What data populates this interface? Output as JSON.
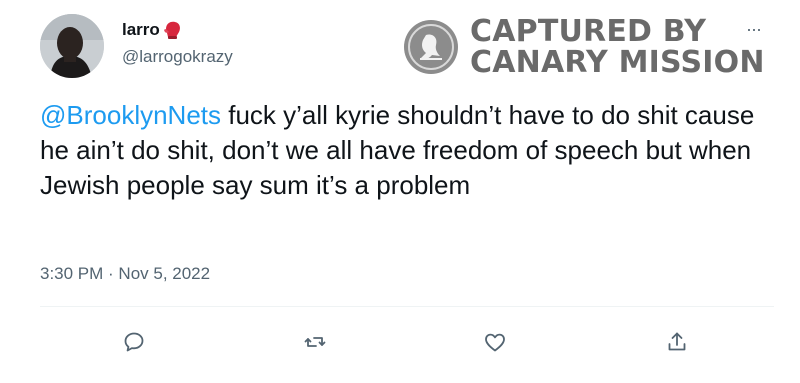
{
  "author": {
    "display_name": "larro",
    "handle": "@larrogokrazy",
    "badge_emoji": "boxing-glove-emoji"
  },
  "watermark": {
    "line1": "CAPTURED BY",
    "line2": "CANARY MISSION",
    "icon": "canary-bird-logo"
  },
  "tweet": {
    "mention": "@BrooklynNets",
    "text": " fuck y’all kyrie shouldn’t have to do shit cause he ain’t do shit, don’t we all have freedom of speech but when Jewish people say sum it’s a problem",
    "timestamp": "3:30 PM · Nov 5, 2022"
  },
  "more_label": "···",
  "actions": [
    "reply-icon",
    "retweet-icon",
    "like-icon",
    "share-icon"
  ],
  "colors": {
    "mention": "#1d9bf0",
    "secondary_text": "#536471",
    "primary_text": "#0f1419",
    "watermark": "#6a6a6a"
  }
}
